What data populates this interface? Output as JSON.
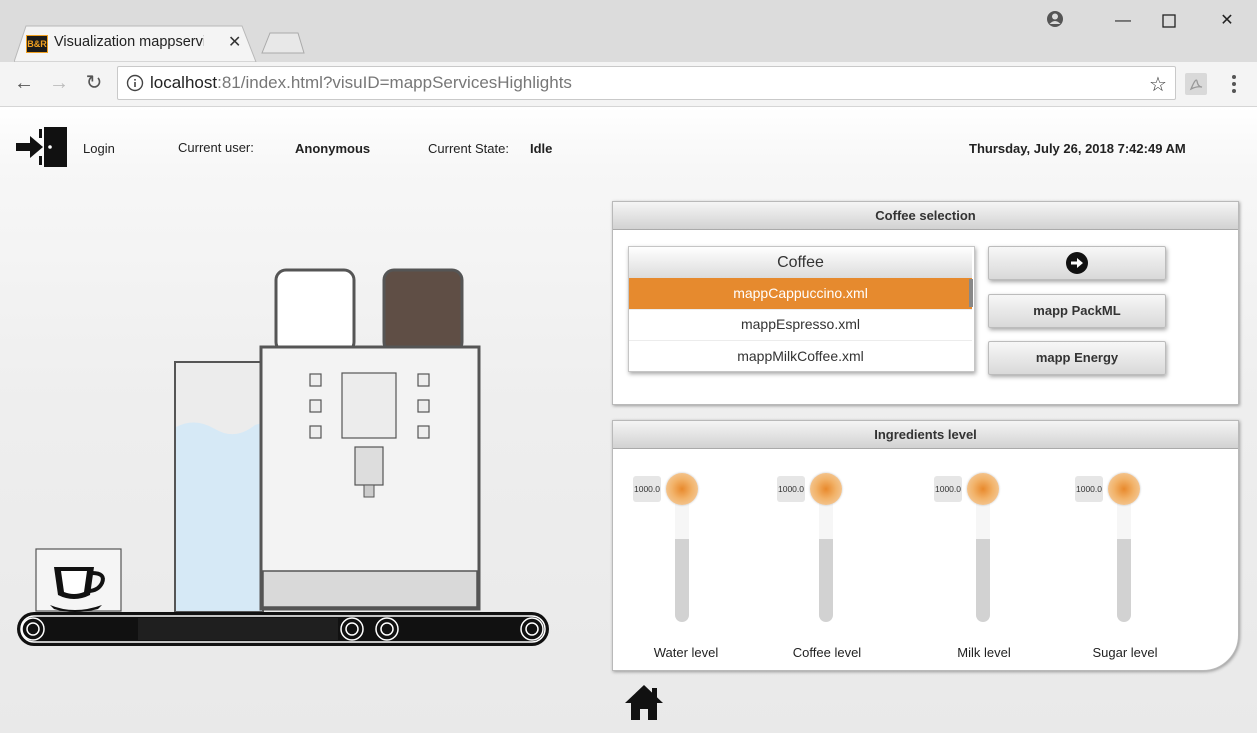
{
  "browser": {
    "tab_title": "Visualization mappservices",
    "tab_favicon_text": "B&R",
    "url_host": "localhost",
    "url_rest": ":81/index.html?visuID=mappServicesHighlights"
  },
  "header": {
    "login_label": "Login",
    "current_user_label": "Current user:",
    "current_user_value": "Anonymous",
    "current_state_label": "Current State:",
    "current_state_value": "Idle",
    "datetime": "Thursday, July 26, 2018 7:42:49 AM"
  },
  "coffee_selection": {
    "title": "Coffee selection",
    "list_header": "Coffee",
    "items": [
      "mappCappuccino.xml",
      "mappEspresso.xml",
      "mappMilkCoffee.xml"
    ],
    "selected_index": 0,
    "buttons": {
      "start_icon": "arrow-right-circle-icon",
      "packml_label": "mapp PackML",
      "energy_label": "mapp Energy"
    }
  },
  "ingredients": {
    "title": "Ingredients level",
    "levels": [
      {
        "label": "Water level",
        "value": "1000.0",
        "fill_fraction": 1.0
      },
      {
        "label": "Coffee level",
        "value": "1000.0",
        "fill_fraction": 1.0
      },
      {
        "label": "Milk level",
        "value": "1000.0",
        "fill_fraction": 1.0
      },
      {
        "label": "Sugar level",
        "value": "1000.0",
        "fill_fraction": 1.0
      }
    ]
  },
  "colors": {
    "accent_orange": "#e68a2e",
    "water_blue": "#d6e9f6",
    "bean_brown": "#5f4e45",
    "machine_outline": "#555555"
  },
  "icons": [
    "login-door-icon",
    "home-icon",
    "coffee-cup-icon"
  ]
}
